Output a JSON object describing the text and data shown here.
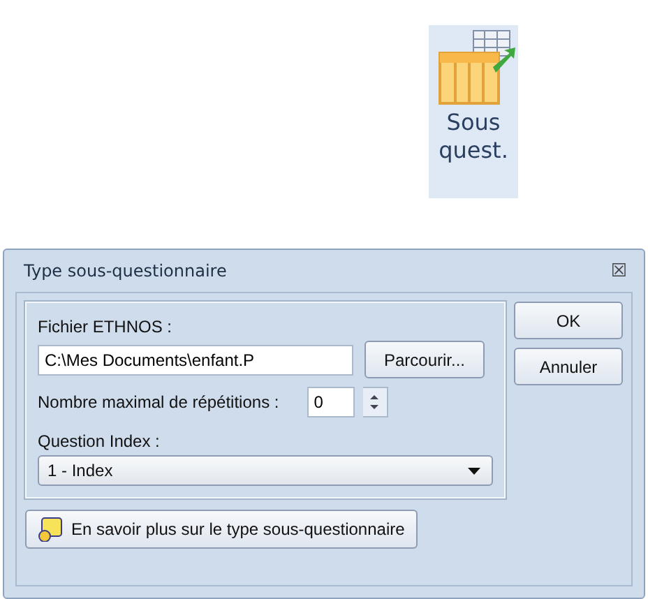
{
  "ribbon_button": {
    "label": [
      "Sous",
      "quest."
    ]
  },
  "dialog": {
    "title": "Type sous-questionnaire",
    "close": "☒",
    "file": {
      "label": "Fichier ETHNOS :",
      "value": "C:\\Mes Documents\\enfant.P",
      "browse": "Parcourir..."
    },
    "repetitions": {
      "label": "Nombre maximal de répétitions :",
      "value": "0"
    },
    "index": {
      "label": "Question Index :",
      "value": "1 - Index"
    },
    "buttons": [
      "OK",
      "Annuler"
    ],
    "help": "En savoir plus sur le type sous-questionnaire"
  }
}
